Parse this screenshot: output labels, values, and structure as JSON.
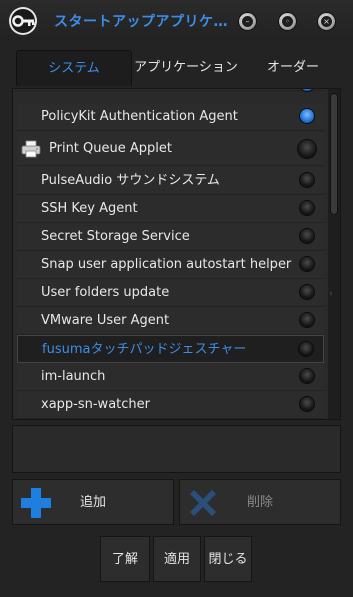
{
  "window": {
    "title": "スタートアップアプリケ…",
    "buttons": [
      "minimize",
      "maximize",
      "close"
    ]
  },
  "tabs": [
    {
      "label": "システム",
      "active": true
    },
    {
      "label": "アプリケーション",
      "active": false
    },
    {
      "label": "オーダー",
      "active": false
    }
  ],
  "list": {
    "items": [
      {
        "label": "PolicyKit Authentication Agent",
        "enabled": true
      },
      {
        "label": "Print Queue Applet",
        "enabled": false,
        "icon": "printer-icon"
      },
      {
        "label": "PulseAudio サウンドシステム",
        "enabled": false
      },
      {
        "label": "SSH Key Agent",
        "enabled": false
      },
      {
        "label": "Secret Storage Service",
        "enabled": false
      },
      {
        "label": "Snap user application autostart helper",
        "enabled": false
      },
      {
        "label": "User folders update",
        "enabled": false
      },
      {
        "label": "VMware User Agent",
        "enabled": false
      },
      {
        "label": "fusumaタッチパッドジェスチャー",
        "enabled": false,
        "selected": true
      },
      {
        "label": "im-launch",
        "enabled": false
      },
      {
        "label": "xapp-sn-watcher",
        "enabled": false
      }
    ]
  },
  "actions": {
    "add_label": "追加",
    "delete_label": "削除"
  },
  "footer": {
    "ok_label": "了解",
    "apply_label": "適用",
    "close_label": "閉じる"
  },
  "colors": {
    "accent": "#3d8ee8",
    "background": "#232323",
    "add_icon": "#1e7fe0",
    "delete_icon": "#2a4f7a"
  }
}
